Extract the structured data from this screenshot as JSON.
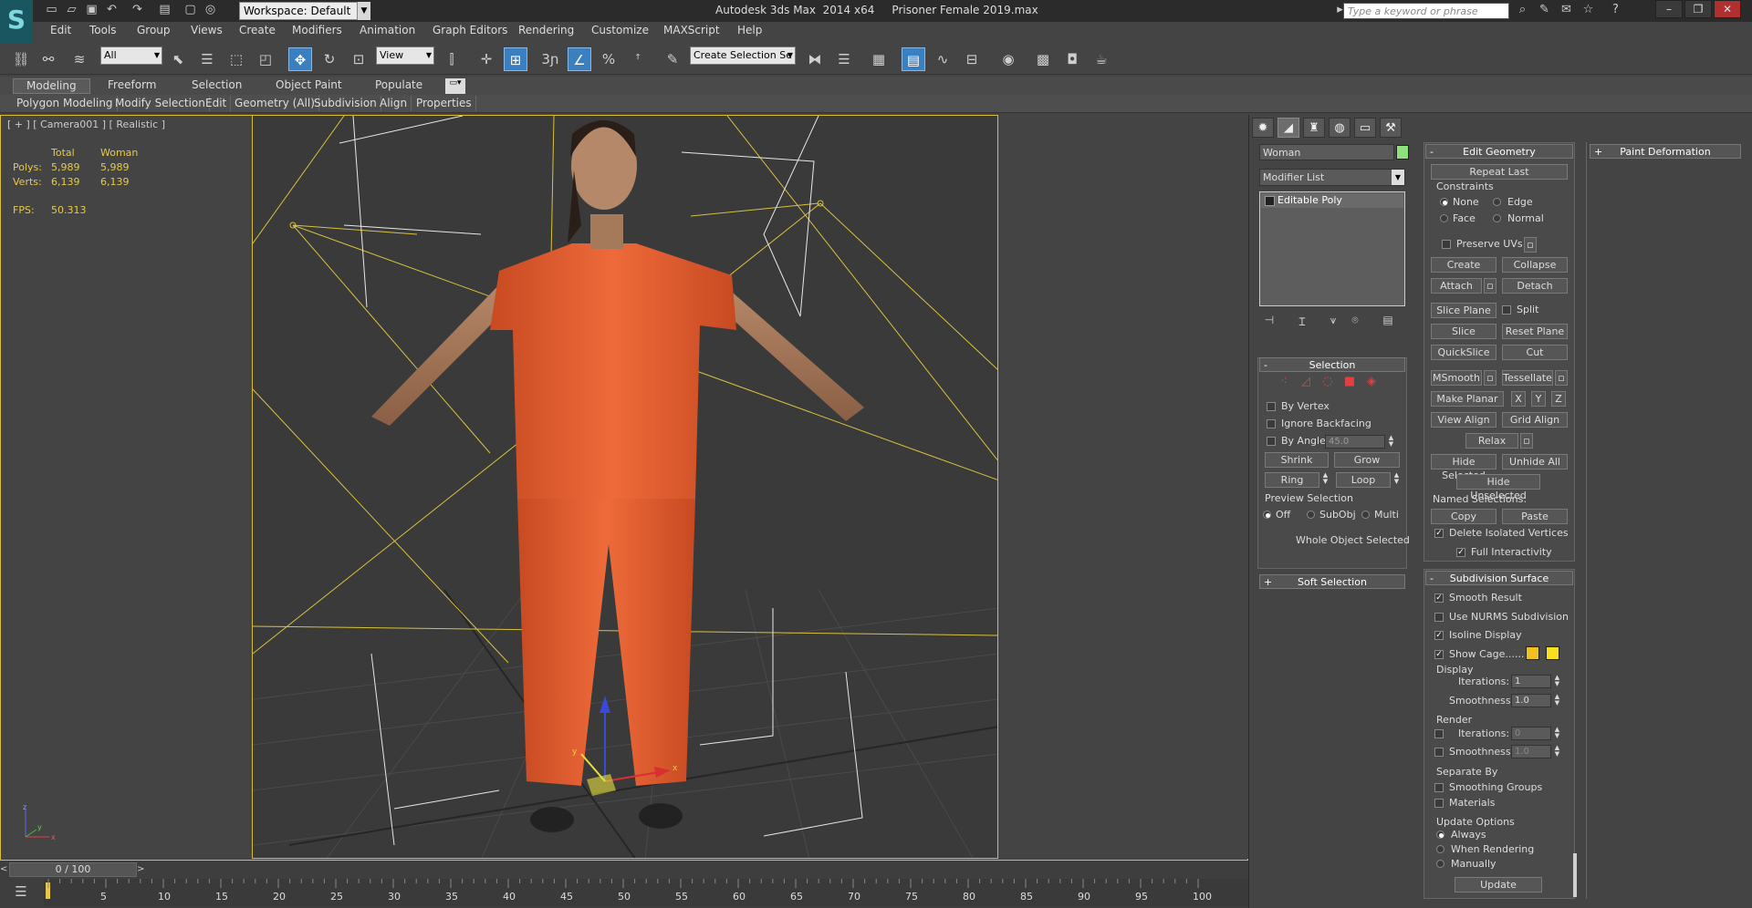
{
  "titlebar": {
    "app_title": "Autodesk 3ds Max  2014 x64     Prisoner Female 2019.max",
    "workspace": "Workspace: Default",
    "help_placeholder": "Type a keyword or phrase"
  },
  "menu": [
    "Edit",
    "Tools",
    "Group",
    "Views",
    "Create",
    "Modifiers",
    "Animation",
    "Graph Editors",
    "Rendering",
    "Customize",
    "MAXScript",
    "Help"
  ],
  "toolbar": {
    "selection_filter": "All",
    "ref_coord": "View",
    "named_selection_placeholder": "Create Selection Se"
  },
  "ribbon": {
    "tabs": [
      "Modeling",
      "Freeform",
      "Selection",
      "Object Paint",
      "Populate"
    ],
    "subtabs": [
      "Polygon Modeling",
      "Modify Selection",
      "Edit",
      "Geometry (All)",
      "Subdivision",
      "Align",
      "Properties"
    ]
  },
  "viewport": {
    "label": "[ + ] [ Camera001 ] [ Realistic ]",
    "stats_header_total": "Total",
    "stats_header_object": "Woman",
    "polys_label": "Polys:",
    "polys_total": "5,989",
    "polys_object": "5,989",
    "verts_label": "Verts:",
    "verts_total": "6,139",
    "verts_object": "6,139",
    "fps_label": "FPS:",
    "fps_value": "50.313",
    "gizmo_x": "x",
    "gizmo_y": "y",
    "axis_z": "z",
    "axis_x": "x",
    "axis_y": "y"
  },
  "timeline": {
    "frame": "0 / 100",
    "ticks": [
      "5",
      "10",
      "15",
      "20",
      "25",
      "30",
      "35",
      "40",
      "45",
      "50",
      "55",
      "60",
      "65",
      "70",
      "75",
      "80",
      "85",
      "90",
      "95",
      "100"
    ]
  },
  "command_panel": {
    "object_name": "Woman",
    "object_color": "#8de07a",
    "modifier_list": "Modifier List",
    "stack_item": "Editable Poly",
    "selection": {
      "title": "Selection",
      "by_vertex": "By Vertex",
      "ignore_backfacing": "Ignore Backfacing",
      "by_angle": "By Angle:",
      "angle_value": "45.0",
      "shrink": "Shrink",
      "grow": "Grow",
      "ring": "Ring",
      "loop": "Loop",
      "preview_selection": "Preview Selection",
      "off": "Off",
      "subobj": "SubObj",
      "multi": "Multi",
      "status": "Whole Object Selected"
    },
    "soft_selection": {
      "title": "Soft Selection"
    },
    "edit_geometry": {
      "title": "Edit Geometry",
      "repeat_last": "Repeat Last",
      "constraints": "Constraints",
      "none": "None",
      "edge": "Edge",
      "face": "Face",
      "normal": "Normal",
      "preserve_uvs": "Preserve UVs",
      "create": "Create",
      "collapse": "Collapse",
      "attach": "Attach",
      "detach": "Detach",
      "slice_plane": "Slice Plane",
      "split": "Split",
      "slice": "Slice",
      "reset_plane": "Reset Plane",
      "quickslice": "QuickSlice",
      "cut": "Cut",
      "msmooth": "MSmooth",
      "tessellate": "Tessellate",
      "make_planar": "Make Planar",
      "x": "X",
      "y": "Y",
      "z": "Z",
      "view_align": "View Align",
      "grid_align": "Grid Align",
      "relax": "Relax",
      "hide_selected": "Hide Selected",
      "unhide_all": "Unhide All",
      "hide_unselected": "Hide Unselected",
      "named_selections": "Named Selections:",
      "copy": "Copy",
      "paste": "Paste",
      "delete_isolated": "Delete Isolated Vertices",
      "full_interactivity": "Full Interactivity"
    },
    "subdivision": {
      "title": "Subdivision Surface",
      "smooth_result": "Smooth Result",
      "use_nurms": "Use NURMS Subdivision",
      "isoline": "Isoline Display",
      "show_cage": "Show Cage......",
      "cage_color_1": "#f0c020",
      "cage_color_2": "#f8e020",
      "display": "Display",
      "iterations": "Iterations:",
      "iterations_value": "1",
      "smoothness": "Smoothness:",
      "smoothness_value": "1.0",
      "render": "Render",
      "render_iterations_value": "0",
      "render_smoothness_value": "1.0",
      "separate_by": "Separate By",
      "smoothing_groups": "Smoothing Groups",
      "materials": "Materials",
      "update_options": "Update Options",
      "always": "Always",
      "when_rendering": "When Rendering",
      "manually": "Manually",
      "update": "Update"
    },
    "paint_deformation": {
      "title": "Paint Deformation"
    }
  }
}
